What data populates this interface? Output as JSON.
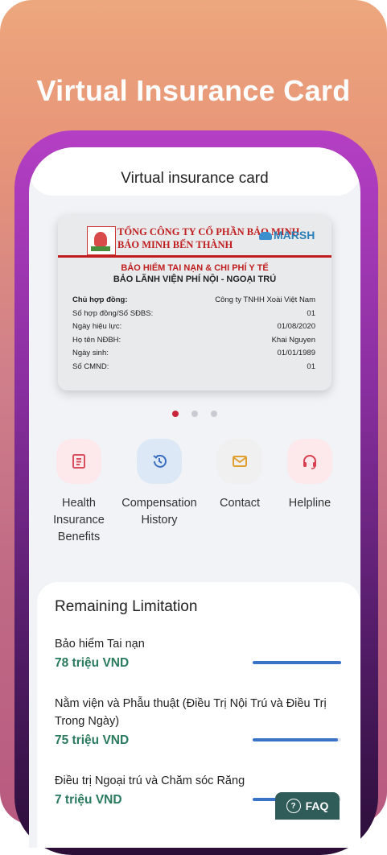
{
  "promo": {
    "title": "Virtual Insurance Card"
  },
  "header": {
    "title": "Virtual insurance card"
  },
  "card": {
    "logo_caption": "BAO MINH",
    "company_line1": "TỔNG CÔNG TY CỔ PHẦN BẢO MINH",
    "company_line2": "BẢO MINH BẾN THÀNH",
    "partner": "MARSH",
    "product_line1": "BẢO HIỂM TAI NẠN & CHI PHÍ Y TẾ",
    "product_line2": "BẢO LÃNH VIỆN PHÍ NỘI - NGOẠI TRÚ",
    "fields": [
      {
        "label": "Chủ hợp đồng:",
        "value": "Công ty TNHH Xoài Việt Nam"
      },
      {
        "label": "Số hợp đồng/Số SĐBS:",
        "value": "01"
      },
      {
        "label": "Ngày hiệu lực:",
        "value": "01/08/2020"
      },
      {
        "label": "Họ tên NĐBH:",
        "value": "Khai Nguyen"
      },
      {
        "label": "Ngày sinh:",
        "value": "01/01/1989"
      },
      {
        "label": "Số CMND:",
        "value": "01"
      }
    ]
  },
  "carousel": {
    "active_index": 0,
    "count": 3
  },
  "actions": [
    {
      "label": "Health Insurance Benefits",
      "icon": "document-icon",
      "color": "#d85060",
      "bg": "#fde8ec"
    },
    {
      "label": "Compensation History",
      "icon": "history-icon",
      "color": "#3a6fc0",
      "bg": "#dde8f7"
    },
    {
      "label": "Contact",
      "icon": "mail-icon",
      "color": "#e0a030",
      "bg": "#f0f0f1"
    },
    {
      "label": "Helpline",
      "icon": "headset-icon",
      "color": "#d84050",
      "bg": "#fde8ec"
    }
  ],
  "limits": {
    "title": "Remaining Limitation",
    "items": [
      {
        "name": "Bảo hiểm Tai nạn",
        "value": "78 triệu VND",
        "fraction": 1.0
      },
      {
        "name": "Nằm viện và Phẫu thuật (Điều Trị Nội Trú và Điều Trị Trong Ngày)",
        "value": "75 triệu VND",
        "fraction": 0.96
      },
      {
        "name": "Điều trị Ngoại trú và Chăm sóc Răng",
        "value": "7 triệu VND",
        "fraction": 0.4
      }
    ]
  },
  "faq": {
    "label": "FAQ"
  },
  "colors": {
    "accent": "#2a7a5d",
    "brand_red": "#c01e1e",
    "faq_bg": "#2f5b58"
  }
}
